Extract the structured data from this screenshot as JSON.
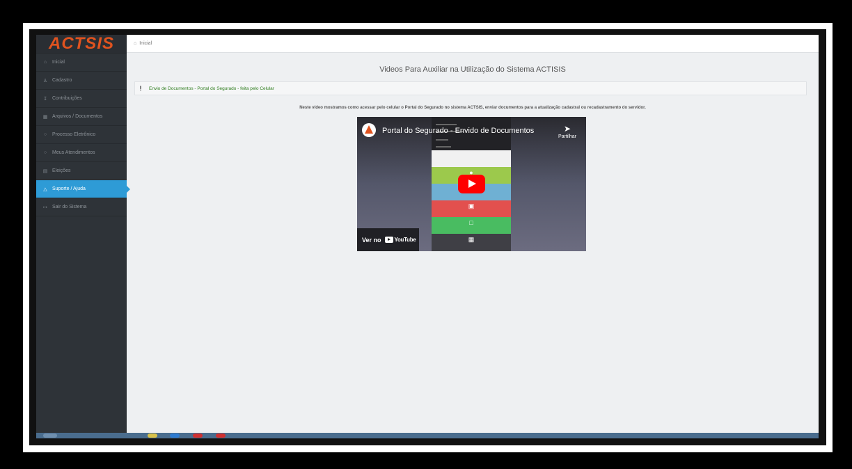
{
  "app": {
    "logo_text": "ACTSIS",
    "brand_color": "#e0531f",
    "accent_color": "#2e9bd6"
  },
  "sidebar": {
    "items": [
      {
        "label": "Inicial",
        "icon": "home-icon",
        "active": false
      },
      {
        "label": "Cadastro",
        "icon": "user-icon",
        "active": false
      },
      {
        "label": "Contribuições",
        "icon": "download-icon",
        "active": false
      },
      {
        "label": "Arquivos / Documentos",
        "icon": "files-icon",
        "active": false
      },
      {
        "label": "Processo Eletrônico",
        "icon": "circle-icon",
        "active": false
      },
      {
        "label": "Meus Atendimentos",
        "icon": "chat-icon",
        "active": false
      },
      {
        "label": "Eleições",
        "icon": "chart-icon",
        "active": false
      },
      {
        "label": "Suporte / Ajuda",
        "icon": "warning-icon",
        "active": true
      },
      {
        "label": "Sair do Sistema",
        "icon": "logout-icon",
        "active": false
      }
    ]
  },
  "breadcrumb": {
    "label": "Inicial",
    "icon": "home-icon"
  },
  "main": {
    "title": "Videos Para Auxiliar na Utilização do Sistema ACTISIS",
    "video_item": {
      "marker": "!",
      "link_text": "Envio de Documentos - Portal do Segurado - feita pelo Celular"
    },
    "description": "Neste vídeo mostramos como acessar pelo celular o Portal do Segurado no sistema ACTSIS, enviar documentos para a atualização cadastral ou recadastramento do servidor."
  },
  "player": {
    "title": "Portal do Segurado - Envido de Documentos",
    "share_label": "Partilhar",
    "watch_on_label": "Ver no",
    "youtube_label": "YouTube"
  }
}
